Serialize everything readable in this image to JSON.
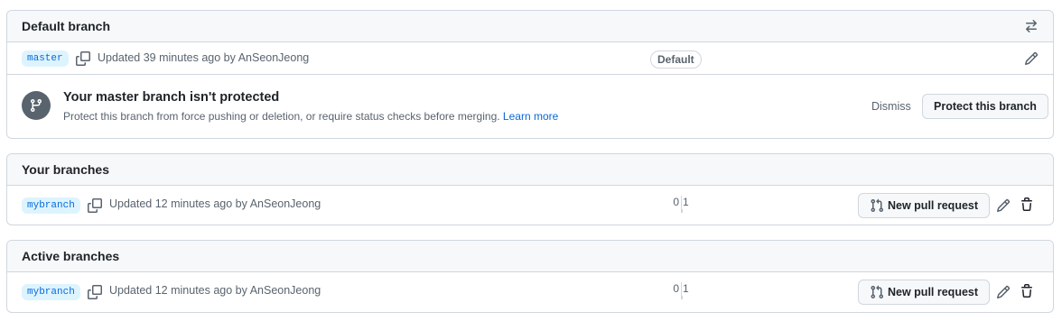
{
  "default_branch": {
    "title": "Default branch",
    "switch_icon": "arrow-switch-icon",
    "row": {
      "name": "master",
      "updated": "Updated 39 minutes ago by",
      "author": "AnSeonJeong",
      "label": "Default"
    },
    "protect": {
      "title": "Your master branch isn't protected",
      "description": "Protect this branch from force pushing or deletion, or require status checks before merging.",
      "learn_more": "Learn more",
      "dismiss": "Dismiss",
      "button": "Protect this branch"
    }
  },
  "your_branches": {
    "title": "Your branches",
    "row": {
      "name": "mybranch",
      "updated": "Updated 12 minutes ago by",
      "author": "AnSeonJeong",
      "behind": "0",
      "ahead": "1",
      "button": "New pull request"
    }
  },
  "active_branches": {
    "title": "Active branches",
    "row": {
      "name": "mybranch",
      "updated": "Updated 12 minutes ago by",
      "author": "AnSeonJeong",
      "behind": "0",
      "ahead": "1",
      "button": "New pull request"
    }
  },
  "colors": {
    "accent": "#0969da",
    "branch_bg": "#ddf4ff",
    "border": "#d0d7de",
    "muted": "#59636e",
    "header_bg": "#f6f8fa"
  }
}
